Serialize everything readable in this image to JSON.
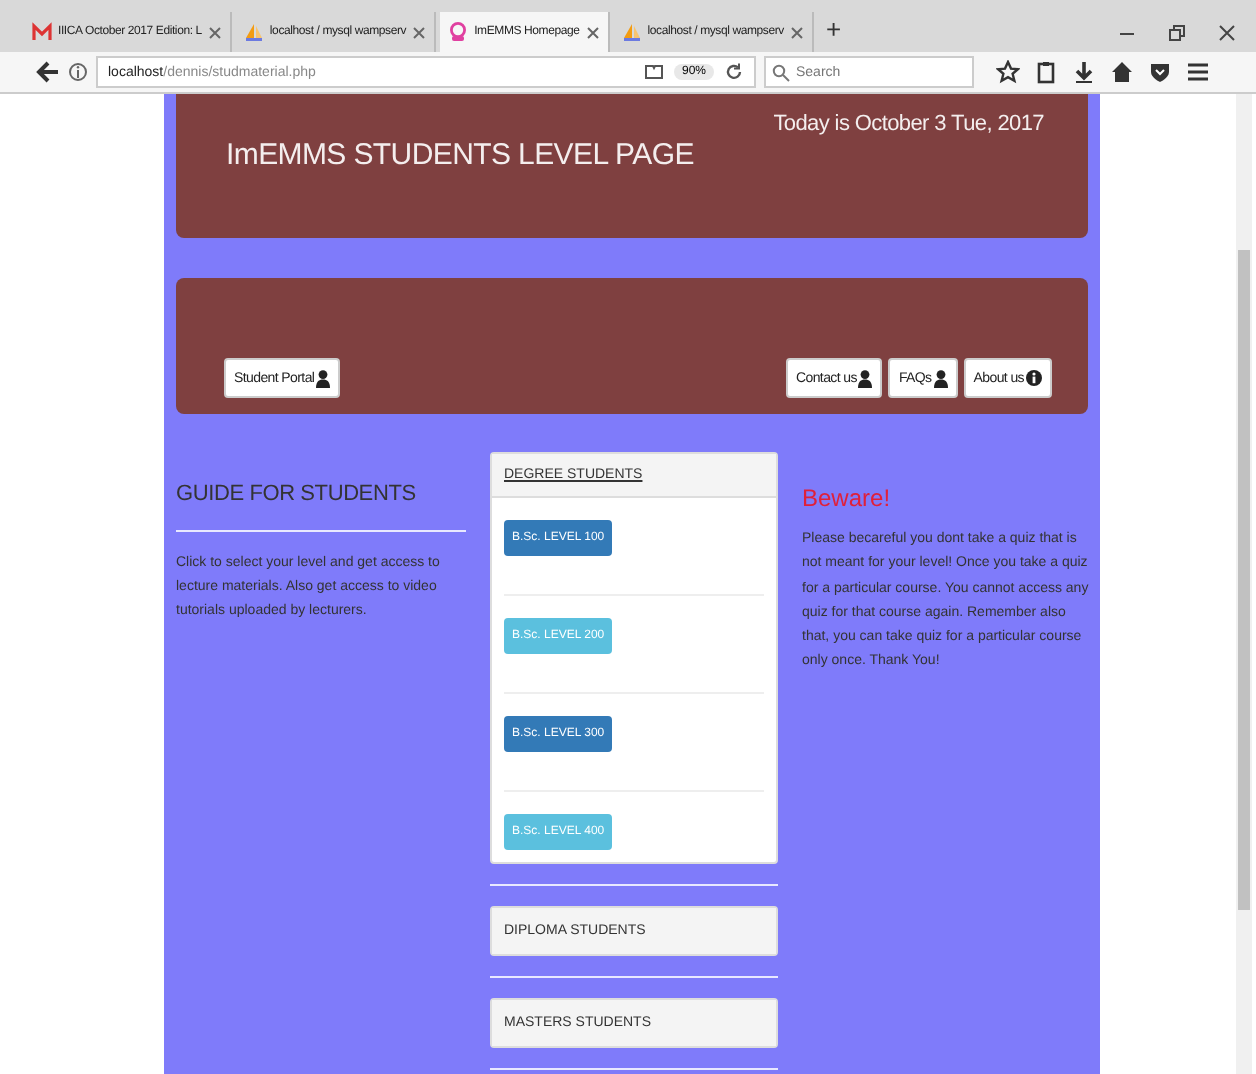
{
  "browser": {
    "tabs": [
      {
        "title": "IIICA October 2017 Edition: L",
        "selected": false
      },
      {
        "title": "localhost / mysql wampserv",
        "selected": false
      },
      {
        "title": "ImEMMS Homepage",
        "selected": true
      },
      {
        "title": "localhost / mysql wampserv",
        "selected": false
      }
    ],
    "new_tab": "+",
    "url_host": "localhost",
    "url_path": "/dennis/studmaterial.php",
    "zoom": "90%",
    "search": {
      "placeholder": "Search"
    }
  },
  "header": {
    "title": "ImEMMS STUDENTS LEVEL PAGE",
    "date": "Today is October 3 Tue, 2017"
  },
  "nav": {
    "left": [
      {
        "label": "Student Portal"
      }
    ],
    "right": [
      {
        "label": "Contact us"
      },
      {
        "label": "FAQs"
      },
      {
        "label": "About us"
      }
    ]
  },
  "guide": {
    "title": "GUIDE FOR STUDENTS",
    "text": "Click to select your level and get access to lecture materials. Also get access to video tutorials uploaded by lecturers."
  },
  "panels": [
    {
      "title": "DEGREE STUDENTS",
      "expanded": true,
      "levels": [
        {
          "label": "B.Sc. LEVEL 100",
          "kind": "primary"
        },
        {
          "label": "B.Sc. LEVEL 200",
          "kind": "info"
        },
        {
          "label": "B.Sc. LEVEL 300",
          "kind": "primary"
        },
        {
          "label": "B.Sc. LEVEL 400",
          "kind": "info"
        }
      ]
    },
    {
      "title": "DIPLOMA STUDENTS",
      "expanded": false
    },
    {
      "title": "MASTERS STUDENTS",
      "expanded": false
    }
  ],
  "warning": {
    "title": "Beware!",
    "text": "Please becareful you dont take a quiz that is not meant for your level! Once you take a quiz for a particular course. You cannot access any quiz for that course again. Remember also that, you can take quiz for a particular course only once. Thank You!"
  }
}
